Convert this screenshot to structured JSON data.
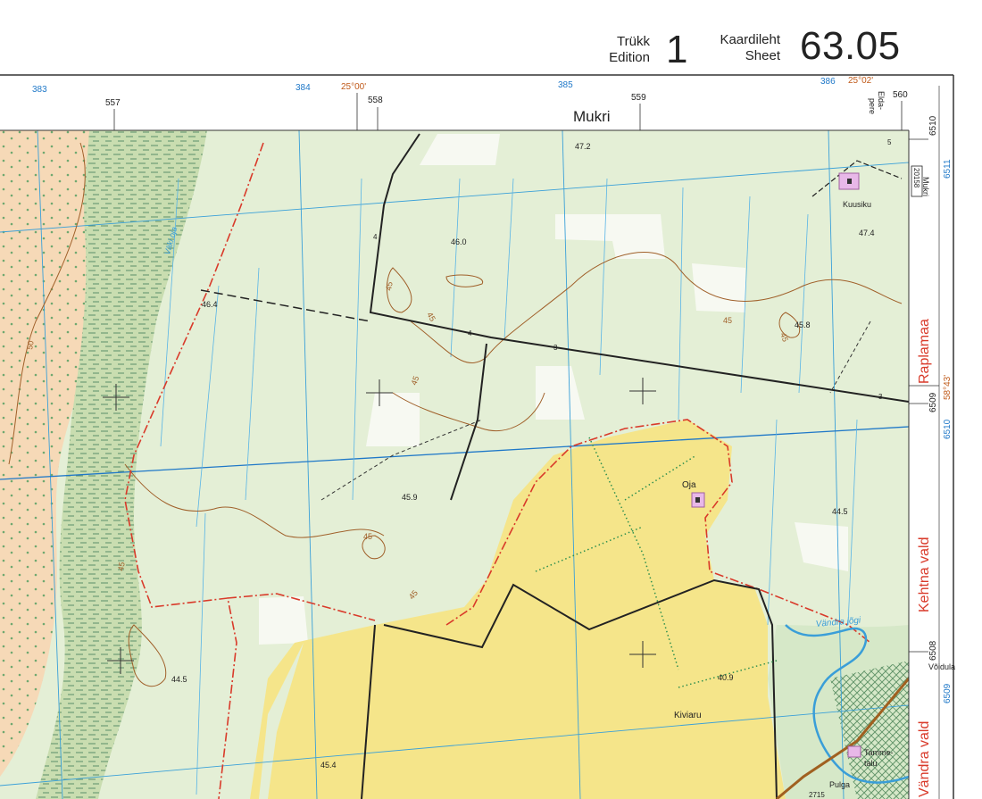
{
  "header": {
    "edition_et": "Trükk",
    "edition_en": "Edition",
    "edition_number": "1",
    "sheet_et": "Kaardileht",
    "sheet_en": "Sheet",
    "sheet_number": "63.05"
  },
  "grid": {
    "top_blue_labels": [
      "383",
      "384",
      "385",
      "386"
    ],
    "top_black_labels": [
      "557",
      "558",
      "559",
      "560"
    ],
    "top_brown_labels": [
      "25°00'",
      "25°02'"
    ],
    "right_blue_labels": [
      "6511",
      "6510",
      "6509"
    ],
    "right_black_labels": [
      "6510",
      "6509",
      "6508"
    ],
    "right_brown_labels": [
      "58°43'"
    ]
  },
  "margin_names": {
    "top_place": "Mukri",
    "top_right_place_1": "Elda-",
    "top_right_place_2": "pere",
    "road_number": "20158",
    "road_name": "Mukri",
    "right_region": "Raplamaa",
    "right_parish_1": "Kehtna vald",
    "right_parish_2": "Vändra vald",
    "right_road_name": "Võidula"
  },
  "places": {
    "kuusiku": "Kuusiku",
    "oja": "Oja",
    "kiviaru": "Kiviaru",
    "tammetalu_1": "Tamme-",
    "tammetalu_2": "talu",
    "pulga": "Pulga",
    "pulga_num": "2715"
  },
  "waters": {
    "vaki_oja": "Väki oja",
    "vandra_jogi": "Vändra jõgi"
  },
  "elevations": {
    "e472": "47.2",
    "e460": "46.0",
    "e474": "47.4",
    "e464": "46.4",
    "e458": "45.8",
    "e459": "45.9",
    "e445a": "44.5",
    "e445b": "44.5",
    "e409": "40.9",
    "e454": "45.4"
  },
  "contours": {
    "c45a": "45",
    "c45b": "45",
    "c45c": "45",
    "c45d": "45",
    "c45e": "45",
    "c45f": "45",
    "c45g": "45",
    "c45h": "45",
    "c50": "50"
  },
  "ditch_numbers": {
    "d4a": "4",
    "d4b": "4",
    "d3a": "3",
    "d3b": "3",
    "d5": "5"
  },
  "colors": {
    "field": "#e4efd6",
    "settlement": "#f5e58a",
    "bog": "#f6d9b7",
    "forest": "#c8deb4",
    "water": "#3a9ed8",
    "grid": "#1f78c8",
    "border": "#d93a2a",
    "contour": "#a0602a",
    "road": "#222222"
  }
}
